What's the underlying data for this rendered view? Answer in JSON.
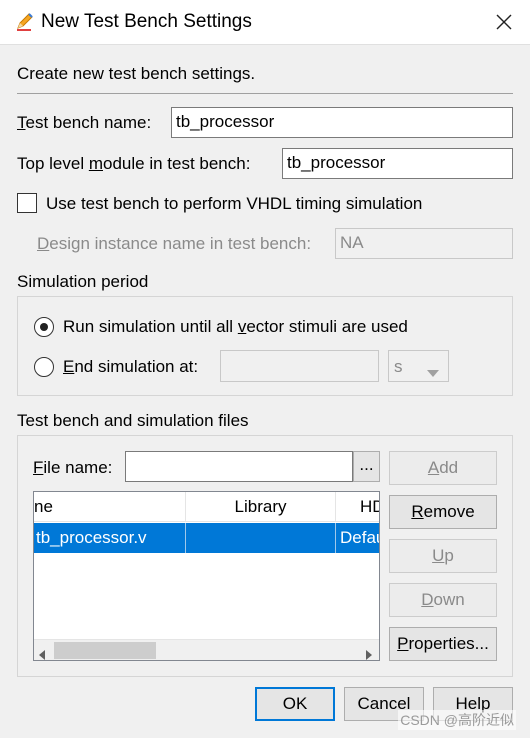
{
  "window": {
    "title": "New Test Bench Settings",
    "icon": "pencil-icon"
  },
  "intro": "Create new test bench settings.",
  "tb_name": {
    "label": {
      "u": "T",
      "rest": "est bench name:"
    },
    "value": "tb_processor"
  },
  "top_module": {
    "label": {
      "pre": "Top level ",
      "u": "m",
      "rest": "odule in test bench:"
    },
    "value": "tb_processor"
  },
  "vhdl_timing": {
    "label": "Use test bench to perform VHDL timing simulation",
    "checked": false
  },
  "design_instance": {
    "label": {
      "u": "D",
      "rest": "esign instance name in test bench:"
    },
    "value": "NA"
  },
  "simulation": {
    "heading": "Simulation period",
    "run_until": {
      "pre": "Run simulation until all ",
      "u": "v",
      "rest": "ector stimuli are used",
      "selected": true
    },
    "end_at": {
      "u": "E",
      "rest": "nd simulation at:",
      "selected": false,
      "value": "",
      "unit": "s"
    }
  },
  "files": {
    "heading": "Test bench and simulation files",
    "file_label": {
      "u": "F",
      "rest": "ile name:"
    },
    "file_value": "",
    "browse_label": "...",
    "columns": [
      "ne",
      "Library",
      "HD"
    ],
    "rows": [
      {
        "name": "tb_processor.v",
        "library": "",
        "hdl": "Defau"
      }
    ],
    "buttons": {
      "add": {
        "u": "A",
        "rest": "dd"
      },
      "remove": {
        "u": "R",
        "rest": "emove"
      },
      "up": {
        "u": "U",
        "rest": "p"
      },
      "down": {
        "u": "D",
        "rest": "own"
      },
      "properties": {
        "u": "P",
        "rest": "roperties..."
      }
    }
  },
  "footer": {
    "ok": "OK",
    "cancel": "Cancel",
    "help": "Help"
  },
  "watermark": "CSDN @高阶近似",
  "colors": {
    "selection": "#0078d7",
    "dialog_bg": "#f0f0f0",
    "disabled_text": "#8a8a8a"
  }
}
